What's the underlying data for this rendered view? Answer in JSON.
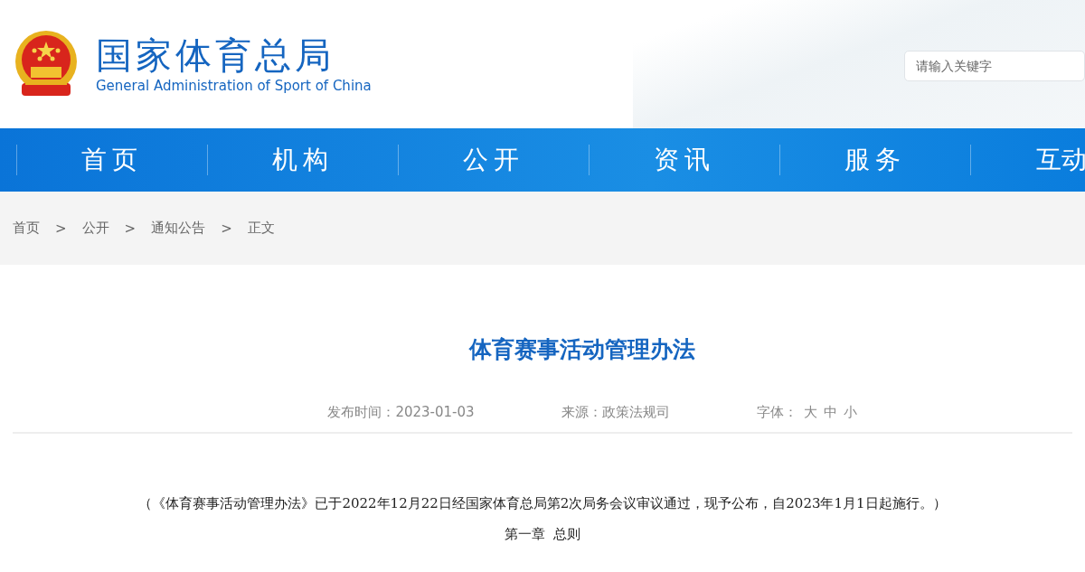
{
  "header": {
    "title_cn": "国家体育总局",
    "title_en": "General Administration of Sport of China",
    "search": {
      "placeholder": "请输入关键字"
    }
  },
  "nav": [
    {
      "label": "首页"
    },
    {
      "label": "机构"
    },
    {
      "label": "公开"
    },
    {
      "label": "资讯"
    },
    {
      "label": "服务"
    },
    {
      "label": "互动"
    }
  ],
  "breadcrumb": {
    "items": [
      "首页",
      "公开",
      "通知公告",
      "正文"
    ],
    "separator": ">"
  },
  "article": {
    "title": "体育赛事活动管理办法",
    "meta": {
      "date": "发布时间：2023-01-03",
      "source": "来源：政策法规司",
      "font_label": "字体：",
      "font_sizes": [
        "大",
        "中",
        "小"
      ]
    },
    "paragraphs": [
      {
        "kind": "note",
        "text": "（《体育赛事活动管理办法》已于2022年12月22日经国家体育总局第2次局务会议审议通过，现予公布，自2023年1月1日起施行。）"
      },
      {
        "kind": "heading",
        "text": "第一章  总则"
      }
    ]
  }
}
